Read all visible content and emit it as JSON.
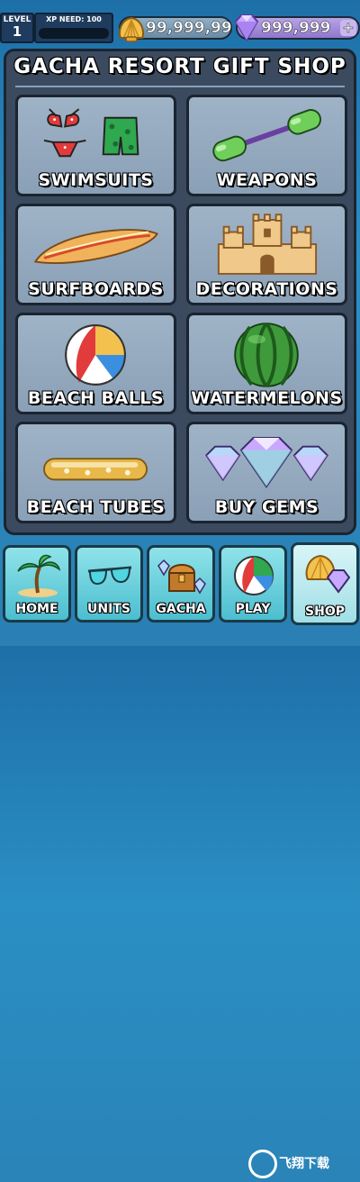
{
  "hud": {
    "level_label": "LEVEL",
    "level_value": "1",
    "xp_label": "XP NEED: 100",
    "xp_progress": 0,
    "coins_value": "99,999,99",
    "gems_value": "999,999",
    "plus_label": "+"
  },
  "shop": {
    "title": "GACHA RESORT GIFT SHOP",
    "tiles": [
      {
        "label": "SWIMSUITS",
        "icon": "swimsuit-icon"
      },
      {
        "label": "WEAPONS",
        "icon": "water-dumbbell-icon"
      },
      {
        "label": "SURFBOARDS",
        "icon": "surfboard-icon"
      },
      {
        "label": "DECORATIONS",
        "icon": "sandcastle-icon"
      },
      {
        "label": "BEACH BALLS",
        "icon": "beach-ball-icon"
      },
      {
        "label": "WATERMELONS",
        "icon": "watermelon-icon"
      },
      {
        "label": "BEACH TUBES",
        "icon": "beach-tube-icon"
      },
      {
        "label": "BUY GEMS",
        "icon": "gems-icon"
      }
    ]
  },
  "nav": {
    "items": [
      {
        "label": "HOME",
        "icon": "palm-tree-icon"
      },
      {
        "label": "UNITS",
        "icon": "sunglasses-icon"
      },
      {
        "label": "GACHA",
        "icon": "treasure-chest-icon"
      },
      {
        "label": "PLAY",
        "icon": "beach-ball-icon"
      },
      {
        "label": "SHOP",
        "icon": "shell-gem-icon"
      }
    ],
    "active": "SHOP"
  },
  "watermark": {
    "text": "飞翔下载"
  },
  "colors": {
    "panel": "#3b4a5e",
    "tile": "#9fb3c7",
    "nav_button": "#4cbecf",
    "coin_gold": "#f2c14e",
    "gem_purple": "#b48cf0"
  }
}
